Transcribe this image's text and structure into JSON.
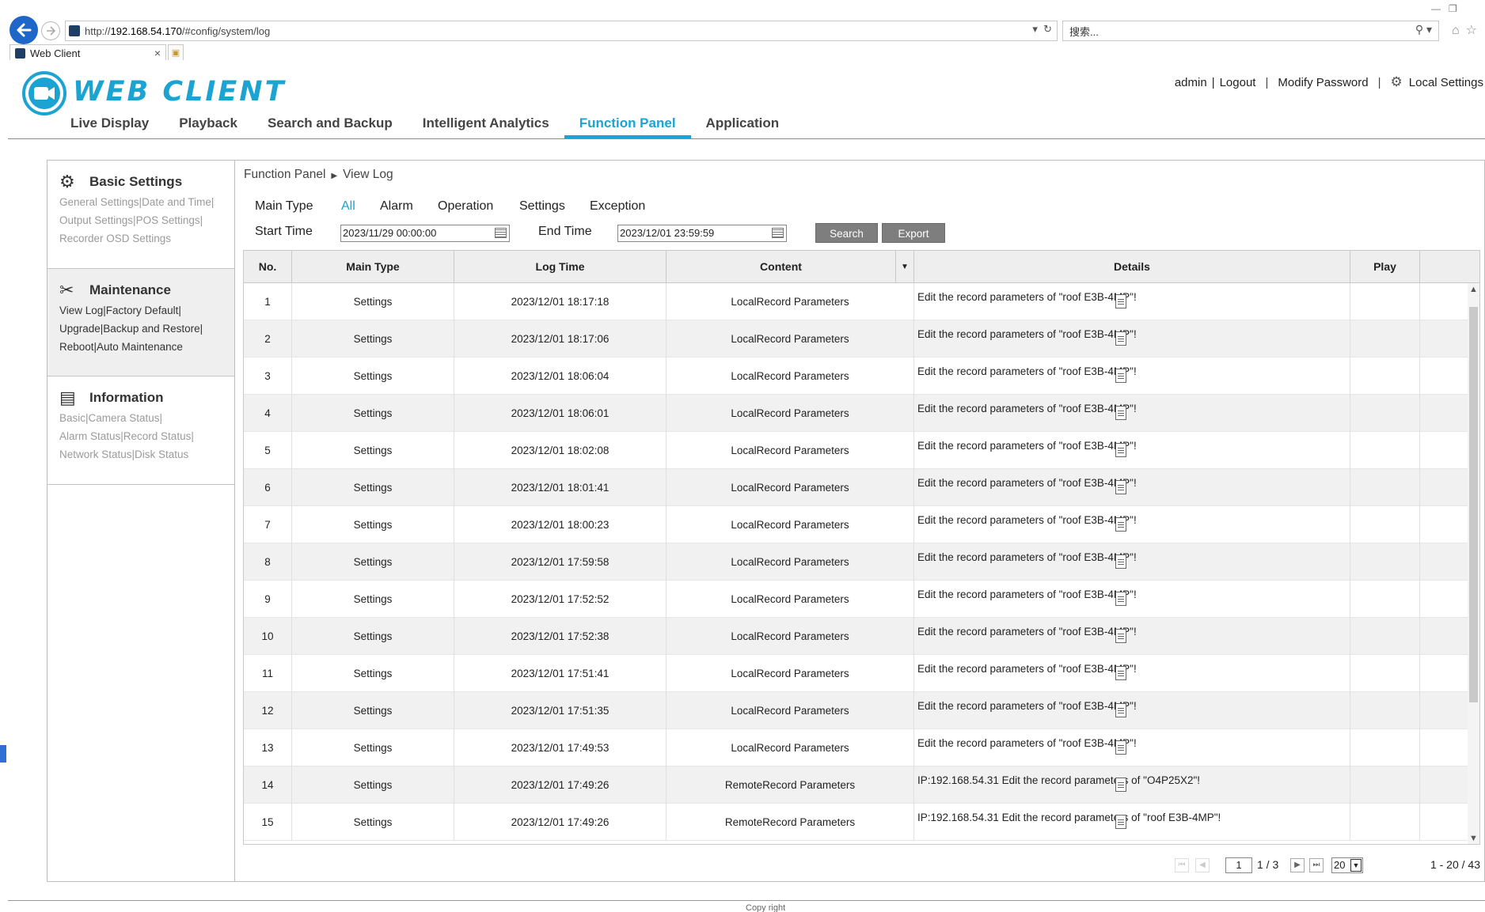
{
  "browser": {
    "url_prefix": "http://",
    "url_host": "192.168.54.170",
    "url_path": "/#config/system/log",
    "search_placeholder": "搜索...",
    "tab_title": "Web Client"
  },
  "header": {
    "logo_text": "WEB CLIENT",
    "user": "admin",
    "logout": "Logout",
    "modify_password": "Modify Password",
    "local_settings": "Local Settings"
  },
  "nav": {
    "items": [
      "Live Display",
      "Playback",
      "Search and Backup",
      "Intelligent Analytics",
      "Function Panel",
      "Application"
    ],
    "active": "Function Panel"
  },
  "sidebar": {
    "sections": [
      {
        "title": "Basic Settings",
        "lines": [
          "General Settings|Date and Time|",
          "Output Settings|POS Settings|",
          "Recorder OSD Settings"
        ]
      },
      {
        "title": "Maintenance",
        "lines": [
          "View Log|Factory Default|",
          "Upgrade|Backup and Restore|",
          "Reboot|Auto Maintenance"
        ]
      },
      {
        "title": "Information",
        "lines": [
          "Basic|Camera Status|",
          "Alarm Status|Record Status|",
          "Network Status|Disk Status"
        ]
      }
    ]
  },
  "breadcrumb": {
    "parent": "Function Panel",
    "current": "View Log"
  },
  "filters": {
    "main_type_label": "Main Type",
    "options": [
      "All",
      "Alarm",
      "Operation",
      "Settings",
      "Exception"
    ],
    "selected": "All",
    "start_label": "Start Time",
    "start_value": "2023/11/29 00:00:00",
    "end_label": "End Time",
    "end_value": "2023/12/01 23:59:59",
    "search_btn": "Search",
    "export_btn": "Export"
  },
  "table": {
    "columns": [
      "No.",
      "Main Type",
      "Log Time",
      "Content",
      "Details",
      "Play"
    ],
    "rows": [
      {
        "no": "1",
        "type": "Settings",
        "time": "2023/12/01 18:17:18",
        "content": "LocalRecord Parameters",
        "details": "Edit the record parameters of \"roof E3B-4MP\"!"
      },
      {
        "no": "2",
        "type": "Settings",
        "time": "2023/12/01 18:17:06",
        "content": "LocalRecord Parameters",
        "details": "Edit the record parameters of \"roof E3B-4MP\"!"
      },
      {
        "no": "3",
        "type": "Settings",
        "time": "2023/12/01 18:06:04",
        "content": "LocalRecord Parameters",
        "details": "Edit the record parameters of \"roof E3B-4MP\"!"
      },
      {
        "no": "4",
        "type": "Settings",
        "time": "2023/12/01 18:06:01",
        "content": "LocalRecord Parameters",
        "details": "Edit the record parameters of \"roof E3B-4MP\"!"
      },
      {
        "no": "5",
        "type": "Settings",
        "time": "2023/12/01 18:02:08",
        "content": "LocalRecord Parameters",
        "details": "Edit the record parameters of \"roof E3B-4MP\"!"
      },
      {
        "no": "6",
        "type": "Settings",
        "time": "2023/12/01 18:01:41",
        "content": "LocalRecord Parameters",
        "details": "Edit the record parameters of \"roof E3B-4MP\"!"
      },
      {
        "no": "7",
        "type": "Settings",
        "time": "2023/12/01 18:00:23",
        "content": "LocalRecord Parameters",
        "details": "Edit the record parameters of \"roof E3B-4MP\"!"
      },
      {
        "no": "8",
        "type": "Settings",
        "time": "2023/12/01 17:59:58",
        "content": "LocalRecord Parameters",
        "details": "Edit the record parameters of \"roof E3B-4MP\"!"
      },
      {
        "no": "9",
        "type": "Settings",
        "time": "2023/12/01 17:52:52",
        "content": "LocalRecord Parameters",
        "details": "Edit the record parameters of \"roof E3B-4MP\"!"
      },
      {
        "no": "10",
        "type": "Settings",
        "time": "2023/12/01 17:52:38",
        "content": "LocalRecord Parameters",
        "details": "Edit the record parameters of \"roof E3B-4MP\"!"
      },
      {
        "no": "11",
        "type": "Settings",
        "time": "2023/12/01 17:51:41",
        "content": "LocalRecord Parameters",
        "details": "Edit the record parameters of \"roof E3B-4MP\"!"
      },
      {
        "no": "12",
        "type": "Settings",
        "time": "2023/12/01 17:51:35",
        "content": "LocalRecord Parameters",
        "details": "Edit the record parameters of \"roof E3B-4MP\"!"
      },
      {
        "no": "13",
        "type": "Settings",
        "time": "2023/12/01 17:49:53",
        "content": "LocalRecord Parameters",
        "details": "Edit the record parameters of \"roof E3B-4MP\"!"
      },
      {
        "no": "14",
        "type": "Settings",
        "time": "2023/12/01 17:49:26",
        "content": "RemoteRecord Parameters",
        "details": "IP:192.168.54.31 Edit the record parameters of \"O4P25X2\"!"
      },
      {
        "no": "15",
        "type": "Settings",
        "time": "2023/12/01 17:49:26",
        "content": "RemoteRecord Parameters",
        "details": "IP:192.168.54.31 Edit the record parameters of \"roof E3B-4MP\"!"
      }
    ]
  },
  "pager": {
    "page_input": "1",
    "page_info": "1 / 3",
    "page_size": "20",
    "range_info": "1 - 20 / 43"
  },
  "footer": {
    "copyright": "Copy right"
  }
}
